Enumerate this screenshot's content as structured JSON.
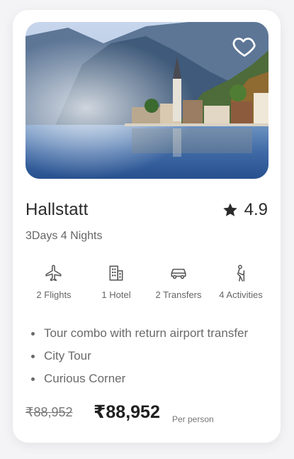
{
  "destination": {
    "name": "Hallstatt",
    "rating": "4.9",
    "duration": "3Days 4 Nights"
  },
  "icons": {
    "favorite": "heart-outline-icon",
    "rating": "star-icon"
  },
  "inclusions": [
    {
      "icon": "airplane-icon",
      "label": "2 Flights"
    },
    {
      "icon": "hotel-icon",
      "label": "1 Hotel"
    },
    {
      "icon": "car-icon",
      "label": "2 Transfers"
    },
    {
      "icon": "hiker-icon",
      "label": "4 Activities"
    }
  ],
  "highlights": [
    "Tour combo with return airport transfer",
    "City Tour",
    "Curious Corner"
  ],
  "pricing": {
    "original_price": "₹88,952",
    "price": "₹88,952",
    "per_label": "Per person"
  }
}
